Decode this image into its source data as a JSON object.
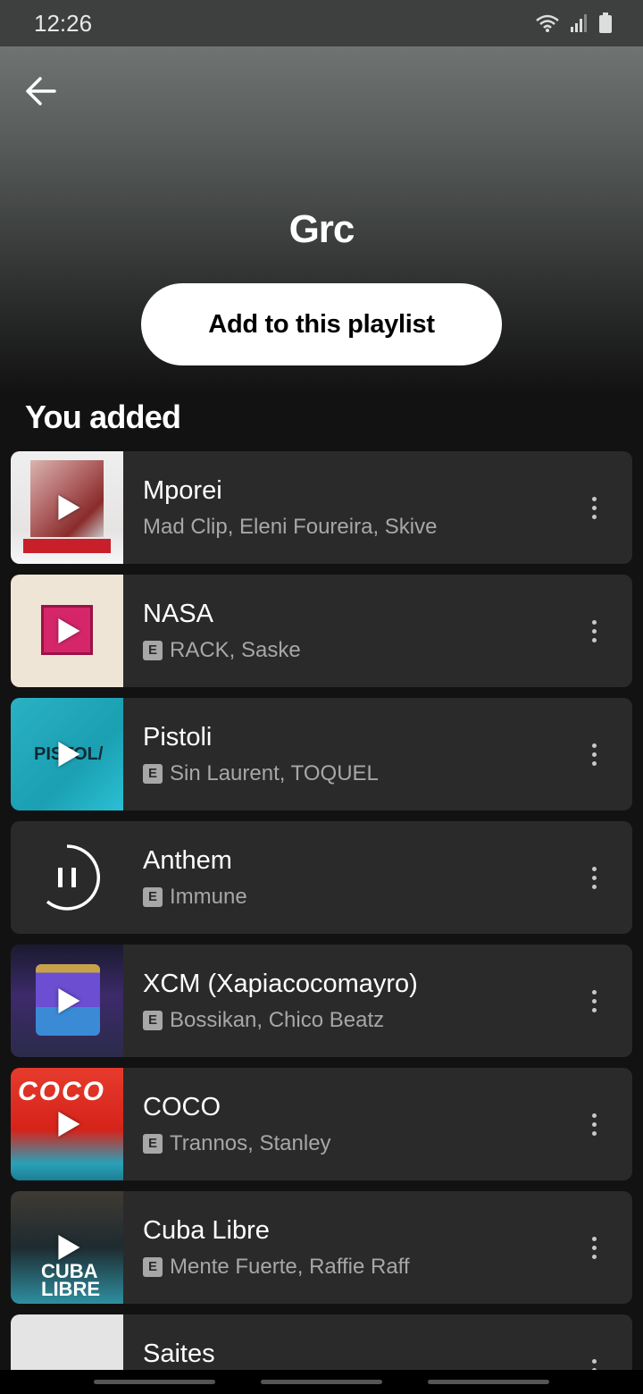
{
  "status_bar": {
    "time": "12:26"
  },
  "header": {
    "playlist_title": "Grc",
    "add_button_label": "Add to this playlist"
  },
  "section": {
    "title": "You added"
  },
  "tracks": [
    {
      "title": "Mporei",
      "artists": "Mad Clip, Eleni Foureira, Skive",
      "explicit": false,
      "state": "play"
    },
    {
      "title": "NASA",
      "artists": "RACK, Saske",
      "explicit": true,
      "state": "play"
    },
    {
      "title": "Pistoli",
      "artists": "Sin Laurent, TOQUEL",
      "explicit": true,
      "state": "play"
    },
    {
      "title": "Anthem",
      "artists": "Immune",
      "explicit": true,
      "state": "playing"
    },
    {
      "title": "XCM (Xapiacocomayro)",
      "artists": "Bossikan, Chico Beatz",
      "explicit": true,
      "state": "play"
    },
    {
      "title": "COCO",
      "artists": "Trannos, Stanley",
      "explicit": true,
      "state": "play"
    },
    {
      "title": "Cuba Libre",
      "artists": "Mente Fuerte, Raffie Raff",
      "explicit": true,
      "state": "play"
    },
    {
      "title": "Saites",
      "artists": "",
      "explicit": false,
      "state": "play"
    }
  ],
  "cover_text": {
    "pistoli": "PISTOL/",
    "coco": "COCO",
    "cuba_libre": "CUBA LIBRE"
  },
  "explicit_label": "E",
  "colors": {
    "background": "#121212",
    "card": "#2a2a2a",
    "subtext": "#a7a7a7",
    "button": "#ffffff"
  }
}
